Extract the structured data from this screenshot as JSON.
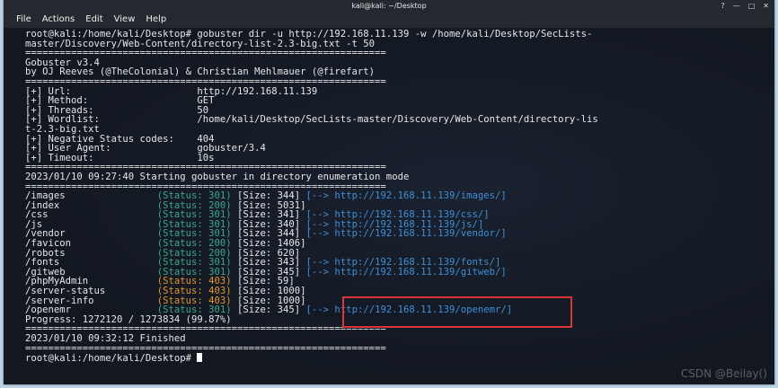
{
  "window": {
    "title": "kali@kali: ~/Desktop",
    "controls": [
      "?",
      "—",
      "□",
      "✕"
    ]
  },
  "menu": [
    "File",
    "Actions",
    "Edit",
    "View",
    "Help"
  ],
  "command_lines": [
    "root@kali:/home/kali/Desktop# gobuster dir -u http://192.168.11.139 -w /home/kali/Desktop/SecLists-",
    "master/Discovery/Web-Content/directory-list-2.3-big.txt -t 50"
  ],
  "separator": "===============================================================",
  "banner": [
    "Gobuster v3.4",
    "by OJ Reeves (@TheColonial) & Christian Mehlmauer (@firefart)"
  ],
  "settings": [
    {
      "key": "[+] Url:",
      "value": "http://192.168.11.139"
    },
    {
      "key": "[+] Method:",
      "value": "GET"
    },
    {
      "key": "[+] Threads:",
      "value": "50"
    },
    {
      "key": "[+] Wordlist:",
      "value": "/home/kali/Desktop/SecLists-master/Discovery/Web-Content/directory-lis"
    },
    {
      "key": "t-2.3-big.txt",
      "value": ""
    },
    {
      "key": "[+] Negative Status codes:",
      "value": "404"
    },
    {
      "key": "[+] User Agent:",
      "value": "gobuster/3.4"
    },
    {
      "key": "[+] Timeout:",
      "value": "10s"
    }
  ],
  "start_line": "2023/01/10 09:27:40 Starting gobuster in directory enumeration mode",
  "results": [
    {
      "path": "/images",
      "status": "(Status: 301)",
      "size": "[Size: 344]",
      "redirect": "[--> http://192.168.11.139/images/]",
      "color": "green"
    },
    {
      "path": "/index",
      "status": "(Status: 200)",
      "size": "[Size: 5031]",
      "redirect": "",
      "color": "green"
    },
    {
      "path": "/css",
      "status": "(Status: 301)",
      "size": "[Size: 341]",
      "redirect": "[--> http://192.168.11.139/css/]",
      "color": "green"
    },
    {
      "path": "/js",
      "status": "(Status: 301)",
      "size": "[Size: 340]",
      "redirect": "[--> http://192.168.11.139/js/]",
      "color": "green"
    },
    {
      "path": "/vendor",
      "status": "(Status: 301)",
      "size": "[Size: 344]",
      "redirect": "[--> http://192.168.11.139/vendor/]",
      "color": "green"
    },
    {
      "path": "/favicon",
      "status": "(Status: 200)",
      "size": "[Size: 1406]",
      "redirect": "",
      "color": "green"
    },
    {
      "path": "/robots",
      "status": "(Status: 200)",
      "size": "[Size: 620]",
      "redirect": "",
      "color": "green"
    },
    {
      "path": "/fonts",
      "status": "(Status: 301)",
      "size": "[Size: 343]",
      "redirect": "[--> http://192.168.11.139/fonts/]",
      "color": "green"
    },
    {
      "path": "/gitweb",
      "status": "(Status: 301)",
      "size": "[Size: 345]",
      "redirect": "[--> http://192.168.11.139/gitweb/]",
      "color": "green"
    },
    {
      "path": "/phpMyAdmin",
      "status": "(Status: 403)",
      "size": "[Size: 59]",
      "redirect": "",
      "color": "orange"
    },
    {
      "path": "/server-status",
      "status": "(Status: 403)",
      "size": "[Size: 1000]",
      "redirect": "",
      "color": "orange"
    },
    {
      "path": "/server-info",
      "status": "(Status: 403)",
      "size": "[Size: 1000]",
      "redirect": "",
      "color": "orange"
    },
    {
      "path": "/openemr",
      "status": "(Status: 301)",
      "size": "[Size: 345]",
      "redirect": "[--> http://192.168.11.139/openemr/]",
      "color": "green"
    }
  ],
  "progress": "Progress: 1272120 / 1273834 (99.87%)",
  "finish_line": "2023/01/10 09:32:12 Finished",
  "prompt": "root@kali:/home/kali/Desktop# ",
  "watermark": "CSDN @Beilay()"
}
